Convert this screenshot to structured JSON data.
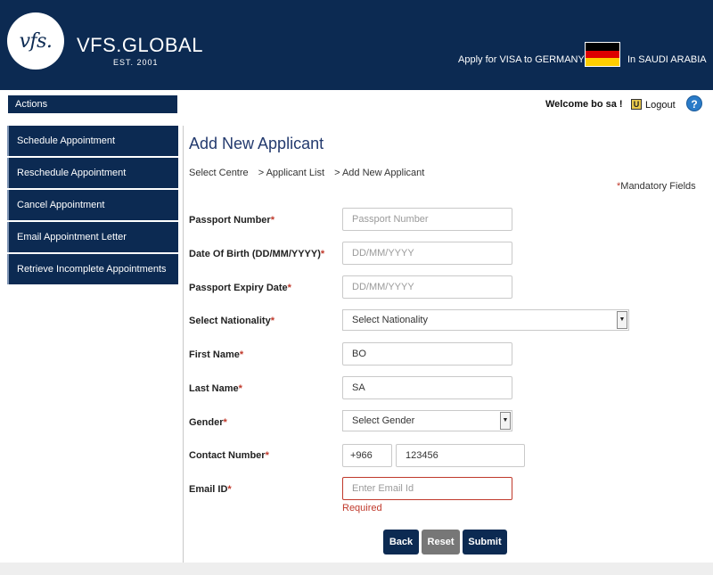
{
  "header": {
    "logo_mark": "vfs.",
    "brand_name": "VFS.GLOBAL",
    "brand_est": "EST. 2001",
    "apply_text": "Apply for VISA to GERMANY",
    "country_text": "In SAUDI ARABIA",
    "flag_colors": [
      "#000000",
      "#dd0000",
      "#ffce00"
    ]
  },
  "sidebar": {
    "title": "Actions",
    "items": [
      {
        "label": "Schedule Appointment"
      },
      {
        "label": "Reschedule Appointment"
      },
      {
        "label": "Cancel Appointment"
      },
      {
        "label": "Email Appointment Letter"
      },
      {
        "label": "Retrieve Incomplete Appointments"
      }
    ]
  },
  "topbar": {
    "welcome": "Welcome bo sa !",
    "logout": "Logout",
    "help": "?"
  },
  "page": {
    "title": "Add New Applicant",
    "breadcrumb": [
      "Select Centre",
      ">  Applicant List",
      ">  Add New Applicant"
    ],
    "mandatory_mark": "*",
    "mandatory_text": "Mandatory Fields"
  },
  "form": {
    "required_mark": "*",
    "passport_number": {
      "label": "Passport Number",
      "value": "",
      "placeholder": "Passport Number"
    },
    "dob": {
      "label": "Date Of Birth (DD/MM/YYYY)",
      "value": "",
      "placeholder": "DD/MM/YYYY"
    },
    "passport_expiry": {
      "label": "Passport Expiry Date",
      "value": "",
      "placeholder": "DD/MM/YYYY"
    },
    "nationality": {
      "label": "Select Nationality",
      "selected": "Select Nationality"
    },
    "first_name": {
      "label": "First Name",
      "value": "BO",
      "placeholder": ""
    },
    "last_name": {
      "label": "Last Name",
      "value": "SA",
      "placeholder": ""
    },
    "gender": {
      "label": "Gender",
      "selected": "Select Gender"
    },
    "contact": {
      "label": "Contact Number",
      "code": "+966",
      "number": "123456"
    },
    "email": {
      "label": "Email ID",
      "value": "",
      "placeholder": "Enter Email Id",
      "error": "Required"
    }
  },
  "buttons": {
    "back": "Back",
    "reset": "Reset",
    "submit": "Submit"
  },
  "colors": {
    "brand_navy": "#0c2a52",
    "error_red": "#c0392b",
    "reset_gray": "#777777"
  }
}
